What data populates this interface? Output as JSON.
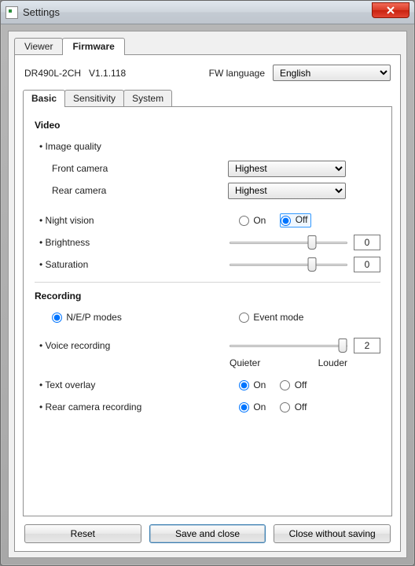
{
  "window": {
    "title": "Settings"
  },
  "tabs_main": {
    "viewer": "Viewer",
    "firmware": "Firmware",
    "active": "firmware"
  },
  "device": {
    "model": "DR490L-2CH",
    "version": "V1.1.118"
  },
  "fw_lang": {
    "label": "FW language",
    "value": "English",
    "options": [
      "English"
    ]
  },
  "tabs_sub": {
    "basic": "Basic",
    "sensitivity": "Sensitivity",
    "system": "System",
    "active": "basic"
  },
  "video": {
    "heading": "Video",
    "image_quality_label": "Image quality",
    "front_camera": {
      "label": "Front camera",
      "value": "Highest",
      "options": [
        "Highest"
      ]
    },
    "rear_camera": {
      "label": "Rear camera",
      "value": "Highest",
      "options": [
        "Highest"
      ]
    },
    "night_vision": {
      "label": "Night vision",
      "on": "On",
      "off": "Off",
      "value": "Off"
    },
    "brightness": {
      "label": "Brightness",
      "value": 0,
      "slider_percent": 70
    },
    "saturation": {
      "label": "Saturation",
      "value": 0,
      "slider_percent": 70
    }
  },
  "recording": {
    "heading": "Recording",
    "mode": {
      "nep": "N/E/P modes",
      "event": "Event mode",
      "value": "nep"
    },
    "voice": {
      "label": "Voice recording",
      "value": 2,
      "slider_percent": 96,
      "quieter": "Quieter",
      "louder": "Louder"
    },
    "text_overlay": {
      "label": "Text overlay",
      "on": "On",
      "off": "Off",
      "value": "On"
    },
    "rear_rec": {
      "label": "Rear camera recording",
      "on": "On",
      "off": "Off",
      "value": "On"
    }
  },
  "buttons": {
    "reset": "Reset",
    "save": "Save and close",
    "close": "Close without saving"
  }
}
